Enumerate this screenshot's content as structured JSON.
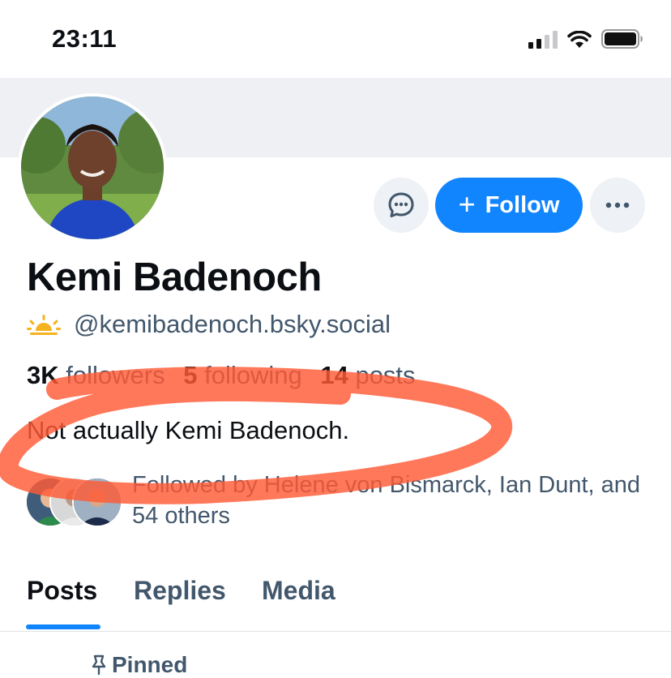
{
  "status_bar": {
    "time": "23:11"
  },
  "profile": {
    "display_name": "Kemi Badenoch",
    "handle": "@kemibadenoch.bsky.social",
    "handle_icon": "sun-badge-icon",
    "stats": {
      "followers_count": "3K",
      "followers_label": "followers",
      "following_count": "5",
      "following_label": "following",
      "posts_count": "14",
      "posts_label": "posts"
    },
    "bio": "Not actually Kemi Badenoch.",
    "followed_by": "Followed by Helene von Bismarck, Ian Dunt, and 54 others"
  },
  "actions": {
    "follow_label": "Follow",
    "follow_icon": "plus-icon",
    "message_icon": "chat-bubble-icon",
    "more_icon": "ellipsis-icon"
  },
  "tabs": [
    {
      "label": "Posts",
      "active": true
    },
    {
      "label": "Replies",
      "active": false
    },
    {
      "label": "Media",
      "active": false
    }
  ],
  "feed": {
    "pinned_label": "Pinned"
  },
  "colors": {
    "accent": "#1185fe",
    "annotation": "#ff5a36",
    "muted_text": "#42576c"
  }
}
